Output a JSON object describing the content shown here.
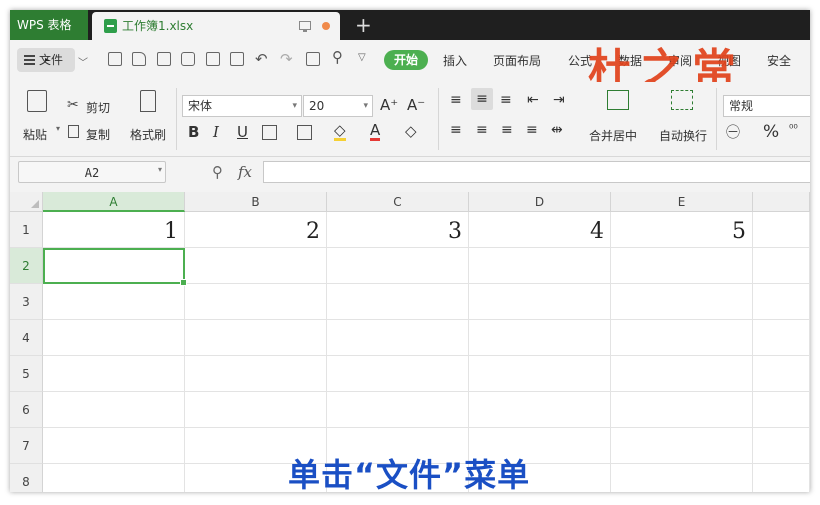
{
  "titlebar": {
    "app_name": "WPS 表格",
    "doc_name": "工作簿1.xlsx",
    "new_tab": "+"
  },
  "menubar": {
    "file_label": "文件",
    "start_label": "开始",
    "tabs": [
      "插入",
      "页面布局",
      "公式",
      "数据",
      "审阅",
      "视图",
      "安全"
    ],
    "brush_overlay": "杜之常"
  },
  "ribbon": {
    "paste": "粘贴",
    "cut": "剪切",
    "copy": "复制",
    "format_painter": "格式刷",
    "font_name": "宋体",
    "font_size": "20",
    "bold": "B",
    "italic": "I",
    "underline": "U",
    "merge_center": "合并居中",
    "wrap_text": "自动换行",
    "number_format": "常规",
    "percent": "%"
  },
  "formula_bar": {
    "name_box": "A2",
    "fx": "fx",
    "content": ""
  },
  "columns": [
    "A",
    "B",
    "C",
    "D",
    "E"
  ],
  "rows": [
    "1",
    "2",
    "3",
    "4",
    "5",
    "6",
    "7",
    "8"
  ],
  "row1_values": [
    "1",
    "2",
    "3",
    "4",
    "5"
  ],
  "caption": "单击“文件”菜单",
  "colors": {
    "accent": "#4caf50",
    "caption": "#1a4fc4",
    "overlay": "#e1421b"
  }
}
